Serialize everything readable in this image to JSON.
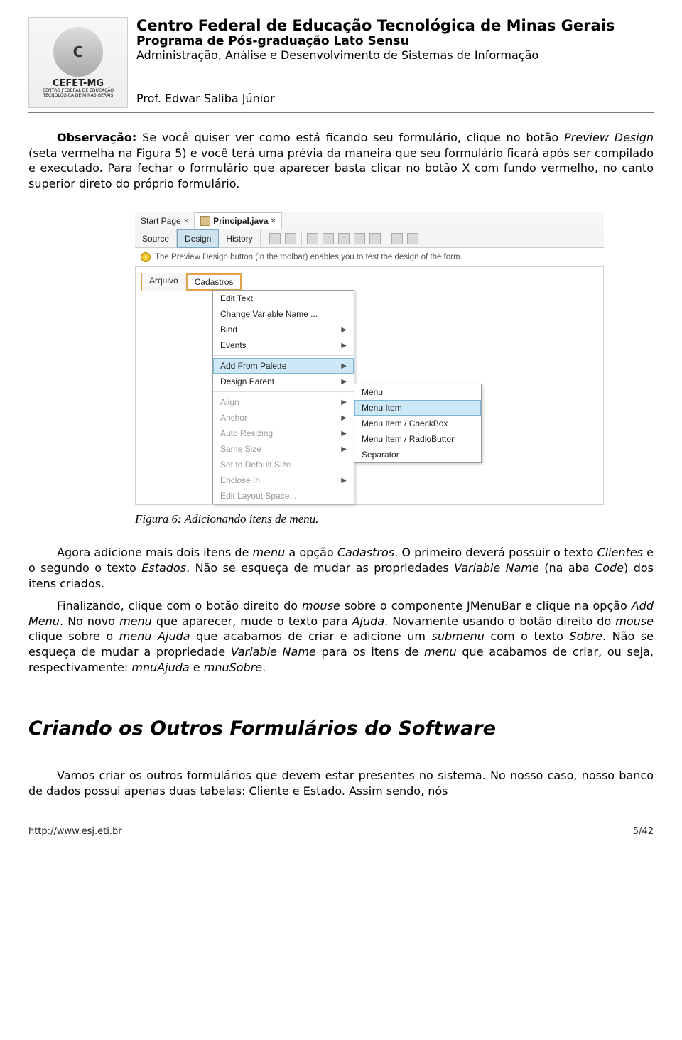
{
  "header": {
    "logo": {
      "short": "C",
      "name": "CEFET-MG",
      "sub": "CENTRO FEDERAL DE EDUCAÇÃO TECNOLÓGICA DE MINAS GERAIS"
    },
    "title": "Centro Federal de Educação Tecnológica de Minas Gerais",
    "sub1": "Programa de Pós-graduação Lato Sensu",
    "sub2": "Administração, Análise e Desenvolvimento de Sistemas de Informação",
    "professor": "Prof. Edwar Saliba Júnior"
  },
  "paragraphs": {
    "p1_label": "Observação:",
    "p1a": " Se você quiser ver como está ficando seu formulário, clique no botão ",
    "p1_it1": "Preview Design",
    "p1b": " (seta vermelha na Figura 5) e você terá uma prévia da maneira que seu formulário ficará após ser compilado e executado. Para fechar o formulário que aparecer basta clicar no botão X com fundo vermelho, no canto superior direto do próprio formulário.",
    "p2a": "Agora adicione mais dois itens de ",
    "p2_it1": "menu",
    "p2b": " a opção ",
    "p2_it2": "Cadastros",
    "p2c": ". O primeiro deverá possuir o texto ",
    "p2_it3": "Clientes",
    "p2d": " e o segundo o texto ",
    "p2_it4": "Estados",
    "p2e": ". Não se esqueça de mudar as propriedades ",
    "p2_it5": "Variable Name",
    "p2f": " (na aba ",
    "p2_it6": "Code",
    "p2g": ") dos itens criados.",
    "p3a": "Finalizando, clique com o botão direito do ",
    "p3_it1": "mouse",
    "p3b": " sobre o componente JMenuBar e clique na opção ",
    "p3_it2": "Add Menu",
    "p3c": ". No novo ",
    "p3_it3": "menu",
    "p3d": " que aparecer, mude o texto para ",
    "p3_it4": "Ajuda",
    "p3e": ". Novamente usando o botão direito do ",
    "p3_it5": "mouse",
    "p3f": " clique sobre o ",
    "p3_it6": "menu Ajuda",
    "p3g": " que acabamos de criar e adicione um ",
    "p3_it7": "submenu",
    "p3h": " com o texto ",
    "p3_it8": "Sobre",
    "p3i": ". Não se esqueça de mudar a propriedade ",
    "p3_it9": "Variable Name",
    "p3j": " para os itens de ",
    "p3_it10": "menu",
    "p3k": " que acabamos de criar, ou seja, respectivamente: ",
    "p3_it11": "mnuAjuda",
    "p3l": " e ",
    "p3_it12": "mnuSobre",
    "p3m": ".",
    "p4": "Vamos criar os outros formulários que devem estar presentes no sistema. No nosso caso, nosso banco de dados possui apenas duas tabelas: Cliente e Estado. Assim sendo, nós"
  },
  "ide": {
    "tabs": {
      "start": "Start Page",
      "file": "Principal.java"
    },
    "views": {
      "source": "Source",
      "design": "Design",
      "history": "History"
    },
    "hint": "The Preview Design button (in the toolbar) enables you to test the design of the form.",
    "menubar": {
      "m1": "Arquivo",
      "m2": "Cadastros"
    },
    "ctx": {
      "i1": "Edit Text",
      "i2": "Change Variable Name ...",
      "i3": "Bind",
      "i4": "Events",
      "i5": "Add From Palette",
      "i6": "Design Parent",
      "i7": "Align",
      "i8": "Anchor",
      "i9": "Auto Resizing",
      "i10": "Same Size",
      "i11": "Set to Default Size",
      "i12": "Enclose In",
      "i13": "Edit Layout Space..."
    },
    "sub": {
      "s1": "Menu",
      "s2": "Menu Item",
      "s3": "Menu Item / CheckBox",
      "s4": "Menu Item / RadioButton",
      "s5": "Separator"
    }
  },
  "caption": "Figura 6: Adicionando itens de menu.",
  "section": "Criando os Outros Formulários do Software",
  "footer": {
    "url": "http://www.esj.eti.br",
    "page": "5/42"
  }
}
